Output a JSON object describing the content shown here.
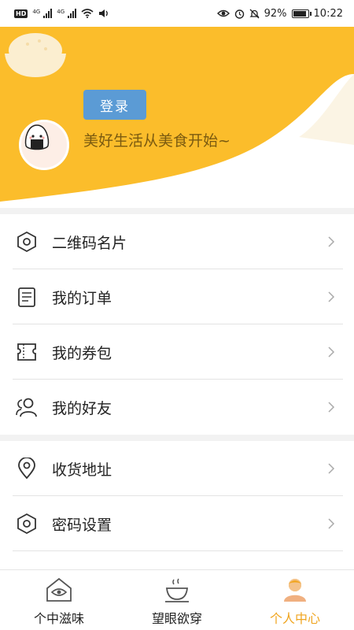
{
  "status_bar": {
    "network_badge": "HD",
    "network_type": "4G",
    "battery": "92%",
    "time": "10:22"
  },
  "header": {
    "login_label": "登录",
    "slogan": "美好生活从美食开始~",
    "accent_color": "#fbbd2b"
  },
  "menu_group_1": [
    {
      "label": "二维码名片",
      "icon": "qrcode-hexagon-icon"
    },
    {
      "label": "我的订单",
      "icon": "order-document-icon"
    },
    {
      "label": "我的券包",
      "icon": "coupon-ticket-icon"
    },
    {
      "label": "我的好友",
      "icon": "friends-icon"
    }
  ],
  "menu_group_2": [
    {
      "label": "收货地址",
      "icon": "location-pin-icon"
    },
    {
      "label": "密码设置",
      "icon": "password-hexagon-icon"
    }
  ],
  "bottom_nav": {
    "tabs": [
      {
        "label": "个中滋味",
        "icon": "house-eye-icon",
        "active": false
      },
      {
        "label": "望眼欲穿",
        "icon": "teacup-icon",
        "active": false
      },
      {
        "label": "个人中心",
        "icon": "person-icon",
        "active": true
      }
    ],
    "active_color": "#f0a520"
  }
}
